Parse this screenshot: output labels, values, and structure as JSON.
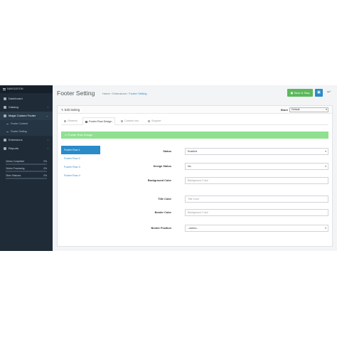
{
  "sidebar": {
    "header": "NAVIGATION",
    "items": [
      {
        "label": "Dashboard",
        "icon": "dashboard-icon",
        "has_arrow": false
      },
      {
        "label": "Catalog",
        "icon": "tag-icon",
        "has_arrow": true
      },
      {
        "label": "Magic Custom Footer",
        "icon": "puzzle-icon",
        "has_arrow": true,
        "active": true
      }
    ],
    "subitems": [
      {
        "label": "Footer Content"
      },
      {
        "label": "Footer Setting"
      }
    ],
    "items_after": [
      {
        "label": "Extensions",
        "icon": "puzzle-icon",
        "has_arrow": true
      },
      {
        "label": "Reports",
        "icon": "bar-chart-icon",
        "has_arrow": true
      }
    ],
    "stats": [
      {
        "label": "Orders Completed",
        "value": "0%",
        "fraction": 0
      },
      {
        "label": "Orders Processing",
        "value": "0%",
        "fraction": 0
      },
      {
        "label": "Other Statuses",
        "value": "0%",
        "fraction": 0
      }
    ]
  },
  "header": {
    "title": "Footer Setting",
    "breadcrumb": [
      "Home",
      "Extensions",
      "Footer Setting"
    ],
    "save_label": "Save & Stay",
    "colors": {
      "save": "#5cb85c",
      "primary": "#2a8bc9"
    }
  },
  "panel": {
    "title": "Edit Setting",
    "store_label": "Store",
    "store_value": "Default",
    "tabs": [
      {
        "label": "General",
        "icon": "gear-icon"
      },
      {
        "label": "Footer Row Design",
        "icon": "design-icon",
        "active": true
      },
      {
        "label": "Custom css",
        "icon": "code-icon"
      },
      {
        "label": "Support",
        "icon": "support-icon"
      }
    ],
    "section_title": "Footer Row Design",
    "section_color": "#8fe08f",
    "rows": [
      {
        "label": "Footer Row 1",
        "active": true
      },
      {
        "label": "Footer Row 2"
      },
      {
        "label": "Footer Row 3"
      },
      {
        "label": "Footer Row 4"
      }
    ],
    "fields": {
      "status": {
        "label": "Status",
        "value": "Enabled"
      },
      "design_status": {
        "label": "Design Status",
        "value": "No"
      },
      "background_color": {
        "label": "Background Color",
        "placeholder": "Background Color"
      },
      "title_color": {
        "label": "Title Color",
        "placeholder": "Title Color"
      },
      "border_color": {
        "label": "Border Color",
        "placeholder": "Background Color"
      },
      "border_position": {
        "label": "Border Position",
        "value": "--select--"
      }
    }
  }
}
